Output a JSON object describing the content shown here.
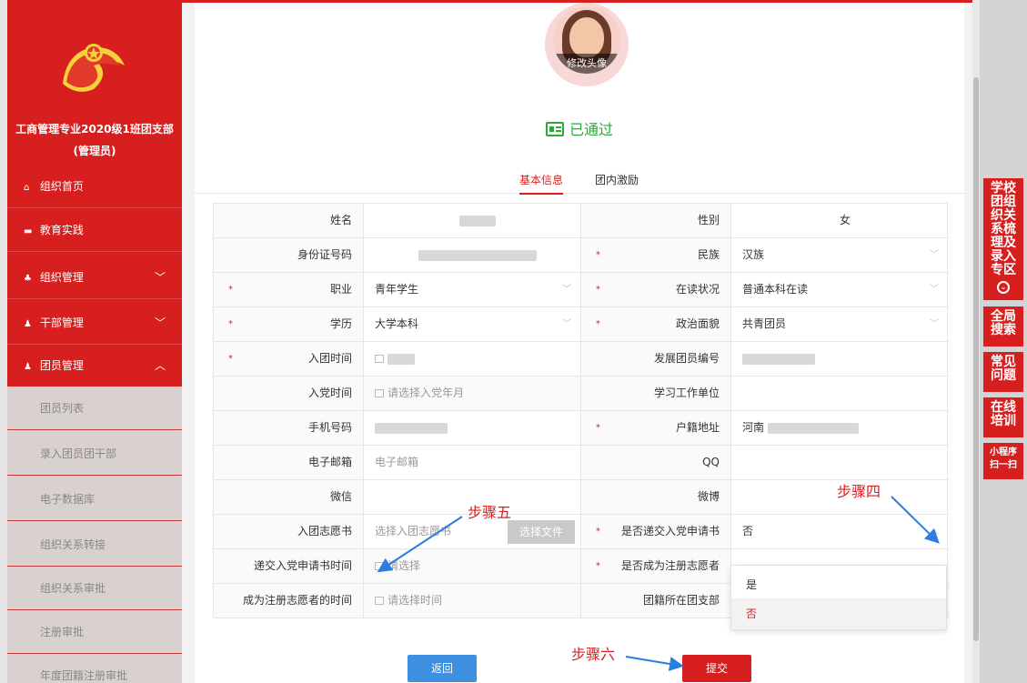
{
  "sidebar": {
    "org_name_line1": "工商管理专业2020级1班团支部",
    "org_name_line2": "(管理员)",
    "nav": [
      {
        "label": "组织首页",
        "icon": "home-icon"
      },
      {
        "label": "教育实践",
        "icon": "folder-icon"
      },
      {
        "label": "组织管理",
        "icon": "org-icon",
        "chevron": "﹀"
      },
      {
        "label": "干部管理",
        "icon": "people-icon",
        "chevron": "﹀"
      },
      {
        "label": "团员管理",
        "icon": "people-icon",
        "chevron": "︿"
      }
    ],
    "sub_items": [
      "团员列表",
      "录入团员团干部",
      "电子数据库",
      "组织关系转接",
      "组织关系审批",
      "注册审批",
      "年度团籍注册审批"
    ]
  },
  "avatar": {
    "caption": "修改头像"
  },
  "status": {
    "label": "已通过"
  },
  "tabs": [
    {
      "label": "基本信息"
    },
    {
      "label": "团内激励"
    }
  ],
  "form": {
    "name_label": "姓名",
    "gender_label": "性别",
    "gender_value": "女",
    "idcard_label": "身份证号码",
    "ethnicity_label": "民族",
    "ethnicity_value": "汉族",
    "job_label": "职业",
    "job_value": "青年学生",
    "study_label": "在读状况",
    "study_value": "普通本科在读",
    "edu_label": "学历",
    "edu_value": "大学本科",
    "politics_label": "政治面貌",
    "politics_value": "共青团员",
    "join_time_label": "入团时间",
    "dev_no_label": "发展团员编号",
    "party_time_label": "入党时间",
    "party_time_placeholder": "请选择入党年月",
    "work_unit_label": "学习工作单位",
    "phone_label": "手机号码",
    "hukou_label": "户籍地址",
    "hukou_value": "河南",
    "email_label": "电子邮箱",
    "email_placeholder": "电子邮箱",
    "qq_label": "QQ",
    "wechat_label": "微信",
    "weibo_label": "微博",
    "letter_label": "入团志愿书",
    "letter_placeholder": "选择入团志愿书",
    "file_button": "选择文件",
    "submitted_label": "是否递交入党申请书",
    "submitted_value": "否",
    "submit_time_label": "递交入党申请书时间",
    "submit_time_placeholder": "请选择",
    "volunteer_label": "是否成为注册志愿者",
    "volunteer_time_label": "成为注册志愿者的时间",
    "volunteer_time_placeholder": "请选择时间",
    "branch_label": "团籍所在团支部"
  },
  "dropdown": {
    "options": [
      "是",
      "否"
    ],
    "selected": "否"
  },
  "buttons": {
    "back": "返回",
    "submit": "提交"
  },
  "annotations": {
    "step4": "步骤四",
    "step5": "步骤五",
    "step6": "步骤六"
  },
  "rightbar": {
    "b1": "学校团组织关系梳理及录入专区",
    "b2": "全局搜索",
    "b3": "常见问题",
    "b4": "在线培训",
    "b5": "小程序扫一扫"
  },
  "colors": {
    "primary": "#d71f1f",
    "success": "#2aaa3a",
    "blue": "#3d8fe0"
  }
}
